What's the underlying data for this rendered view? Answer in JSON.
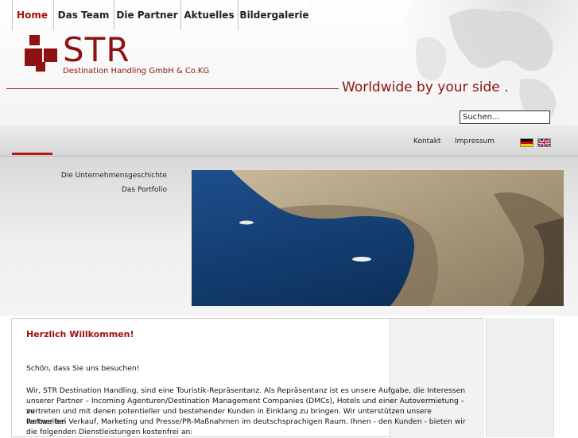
{
  "brand": {
    "name": "STR",
    "subtitle": "Destination Handling GmbH & Co.KG",
    "tagline": "Worldwide by your side ."
  },
  "search": {
    "value": "Suchen..."
  },
  "nav": {
    "items": [
      {
        "label": "Home",
        "active": true
      },
      {
        "label": "Das Team"
      },
      {
        "label": "Die Partner"
      },
      {
        "label": "Aktuelles"
      },
      {
        "label": "Bildergalerie"
      }
    ],
    "utility": [
      "Kontakt",
      "Impressum"
    ],
    "languages": [
      "de-flag-icon",
      "uk-flag-icon"
    ]
  },
  "subnav": {
    "items": [
      "Die Unternehmensgeschichte",
      "Das Portfolio"
    ]
  },
  "content": {
    "heading": "Herzlich Willkommen!",
    "intro": "Schön, dass Sie uns besuchen!",
    "body_lines": [
      "Wir, STR Destination Handling, sind eine Touristik-Repräsentanz. Als Repräsentanz ist es unsere Aufgabe, die Interessen",
      "unserer Partner – Incoming Agenturen/Destination Management Companies (DMCs), Hotels und einer Autovermietung – zu",
      "vertreten und mit denen potentieller und bestehender Kunden in Einklang zu bringen. Wir unterstützen unsere weltweiten",
      "Partner bei Verkauf, Marketing und Presse/PR-Maßnahmen im deutschsprachigen Raum. Ihnen - den Kunden - bieten wir",
      "die folgenden Dienstleistungen kostenfrei an:"
    ]
  },
  "colors": {
    "brand_red": "#8e1212",
    "nav_active": "#a01010"
  }
}
